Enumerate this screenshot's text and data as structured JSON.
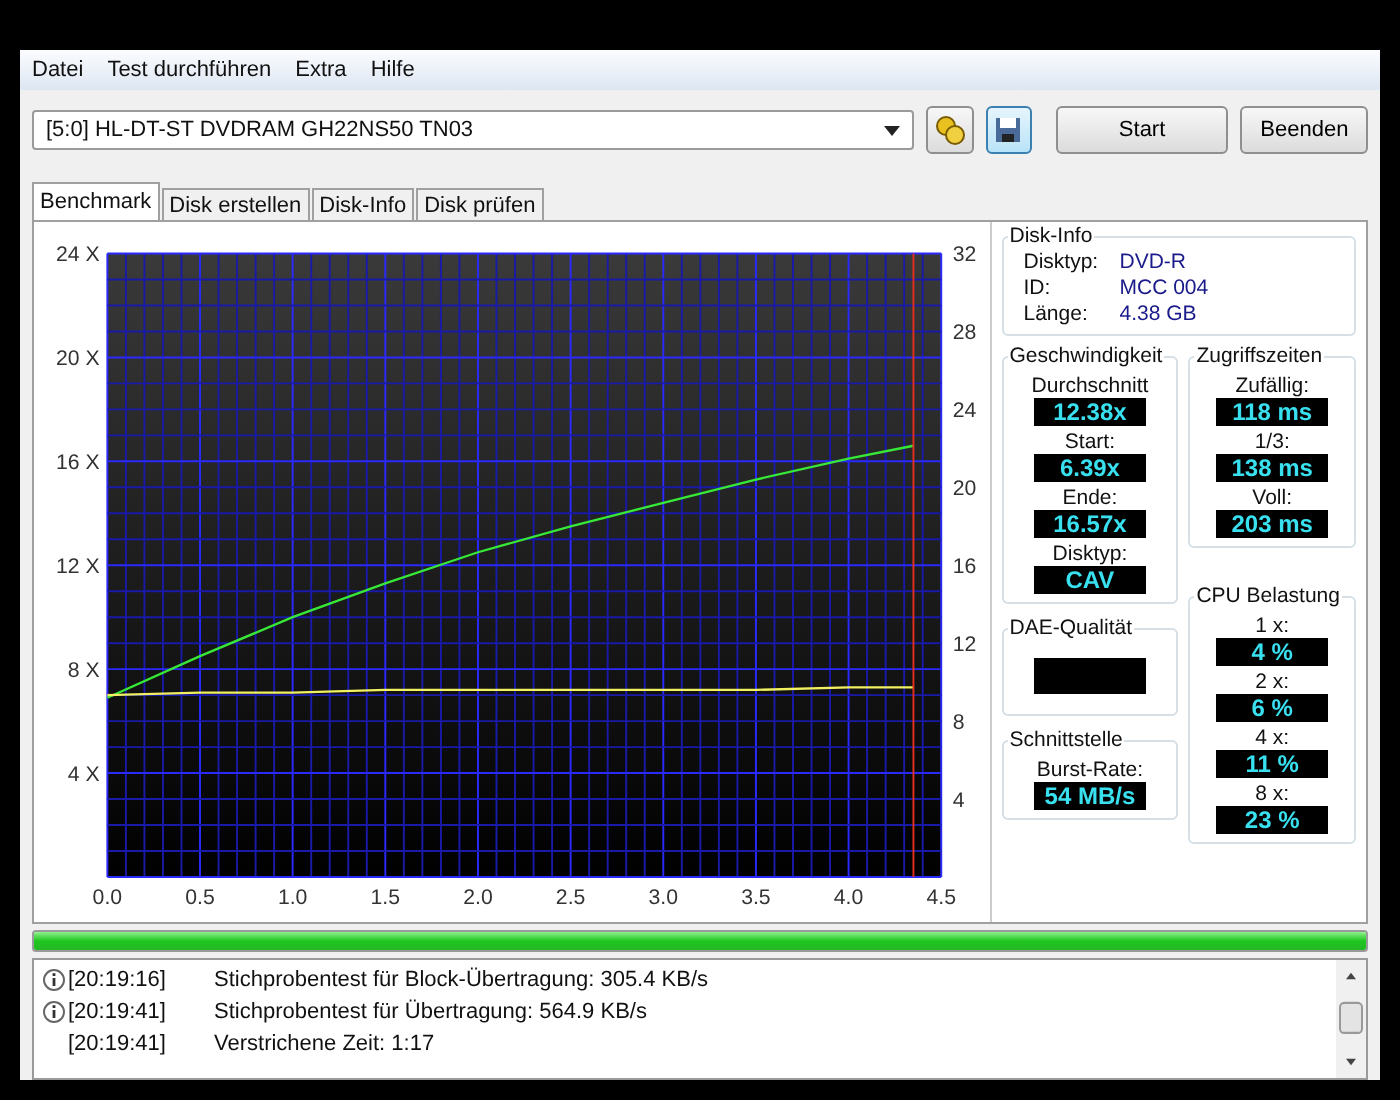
{
  "menu": [
    "Datei",
    "Test durchführen",
    "Extra",
    "Hilfe"
  ],
  "toolbar": {
    "drive": "[5:0]  HL-DT-ST DVDRAM GH22NS50 TN03",
    "buttons": [
      "Start",
      "Beenden"
    ]
  },
  "tabs": [
    {
      "label": "Benchmark",
      "selected": true
    },
    {
      "label": "Disk erstellen",
      "selected": false
    },
    {
      "label": "Disk-Info",
      "selected": false
    },
    {
      "label": "Disk prüfen",
      "selected": false
    }
  ],
  "chart_data": {
    "type": "line",
    "x": [
      0,
      0.5,
      1.0,
      1.5,
      2.0,
      2.5,
      3.0,
      3.5,
      4.0,
      4.35
    ],
    "series": [
      {
        "color": "#38e838",
        "values": [
          6.9,
          8.5,
          10.0,
          11.3,
          12.5,
          13.5,
          14.4,
          15.3,
          16.1,
          16.6
        ]
      },
      {
        "color": "#f0f060",
        "values": [
          7.0,
          7.1,
          7.1,
          7.2,
          7.2,
          7.2,
          7.2,
          7.2,
          7.3,
          7.3
        ]
      }
    ],
    "xlim": [
      0,
      4.5
    ],
    "ylim": [
      0,
      24
    ],
    "xticks": [
      {
        "value": 0,
        "label": "0.0"
      },
      {
        "value": 0.5,
        "label": "0.5"
      },
      {
        "value": 1,
        "label": "1.0"
      },
      {
        "value": 1.5,
        "label": "1.5"
      },
      {
        "value": 2,
        "label": "2.0"
      },
      {
        "value": 2.5,
        "label": "2.5"
      },
      {
        "value": 3,
        "label": "3.0"
      },
      {
        "value": 3.5,
        "label": "3.5"
      },
      {
        "value": 4,
        "label": "4.0"
      },
      {
        "value": 4.5,
        "label": "4.5"
      }
    ],
    "yticks": [
      {
        "value": 4,
        "label": "4 X"
      },
      {
        "value": 8,
        "label": "8 X"
      },
      {
        "value": 12,
        "label": "12 X"
      },
      {
        "value": 16,
        "label": "16 X"
      },
      {
        "value": 20,
        "label": "20 X"
      },
      {
        "value": 24,
        "label": "24 X"
      }
    ],
    "y2ticks": [
      4,
      8,
      12,
      16,
      20,
      24,
      28,
      32
    ],
    "y2lim": [
      0,
      32
    ],
    "grid": true,
    "ref_lines": [
      {
        "axis": "x",
        "value": 4.35,
        "color": "#e03020"
      }
    ]
  },
  "disk_info": {
    "title": "Disk-Info",
    "rows": [
      {
        "label": "Disktyp:",
        "value": "DVD-R"
      },
      {
        "label": "ID:",
        "value": "MCC 004"
      },
      {
        "label": "Länge:",
        "value": "4.38 GB"
      }
    ]
  },
  "speed": {
    "title": "Geschwindigkeit",
    "items": [
      {
        "label": "Durchschnitt",
        "value": "12.38x"
      },
      {
        "label": "Start:",
        "value": "6.39x"
      },
      {
        "label": "Ende:",
        "value": "16.57x"
      },
      {
        "label": "Disktyp:",
        "value": "CAV"
      }
    ]
  },
  "access": {
    "title": "Zugriffszeiten",
    "items": [
      {
        "label": "Zufällig:",
        "value": "118 ms"
      },
      {
        "label": "1/3:",
        "value": "138 ms"
      },
      {
        "label": "Voll:",
        "value": "203 ms"
      }
    ]
  },
  "dae": {
    "title": "DAE-Qualität"
  },
  "interface": {
    "title": "Schnittstelle",
    "items": [
      {
        "label": "Burst-Rate:",
        "value": "54 MB/s"
      }
    ]
  },
  "cpu": {
    "title": "CPU Belastung",
    "items": [
      {
        "label": "1 x:",
        "value": "4 %"
      },
      {
        "label": "2 x:",
        "value": "6 %"
      },
      {
        "label": "4 x:",
        "value": "11 %"
      },
      {
        "label": "8 x:",
        "value": "23 %"
      }
    ]
  },
  "progress": {
    "level": 1.0
  },
  "log": [
    {
      "kind": "info",
      "time": "[20:19:16]",
      "message": "Stichprobentest für Block-Übertragung: 305.4 KB/s"
    },
    {
      "kind": "info",
      "time": "[20:19:41]",
      "message": "Stichprobentest für Übertragung: 564.9 KB/s"
    },
    {
      "kind": "plain",
      "time": "[20:19:41]",
      "message": "Verstrichene Zeit: 1:17"
    }
  ]
}
